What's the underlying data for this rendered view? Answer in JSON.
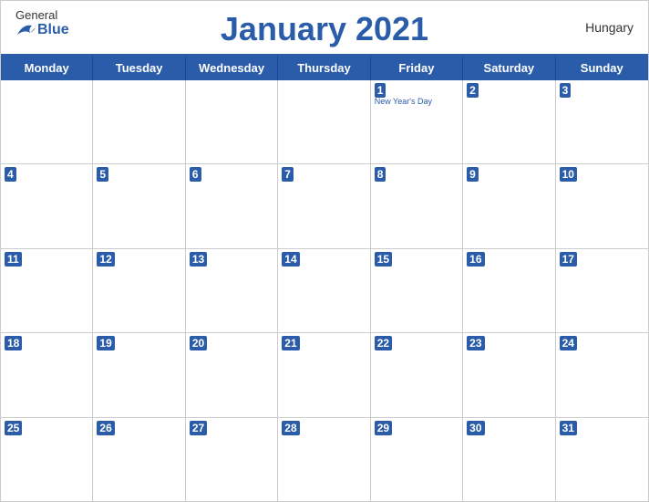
{
  "header": {
    "logo_general": "General",
    "logo_blue": "Blue",
    "title": "January 2021",
    "country": "Hungary"
  },
  "day_headers": [
    "Monday",
    "Tuesday",
    "Wednesday",
    "Thursday",
    "Friday",
    "Saturday",
    "Sunday"
  ],
  "weeks": [
    [
      {
        "day": "",
        "holiday": ""
      },
      {
        "day": "",
        "holiday": ""
      },
      {
        "day": "",
        "holiday": ""
      },
      {
        "day": "",
        "holiday": ""
      },
      {
        "day": "1",
        "holiday": "New Year's Day"
      },
      {
        "day": "2",
        "holiday": ""
      },
      {
        "day": "3",
        "holiday": ""
      }
    ],
    [
      {
        "day": "4",
        "holiday": ""
      },
      {
        "day": "5",
        "holiday": ""
      },
      {
        "day": "6",
        "holiday": ""
      },
      {
        "day": "7",
        "holiday": ""
      },
      {
        "day": "8",
        "holiday": ""
      },
      {
        "day": "9",
        "holiday": ""
      },
      {
        "day": "10",
        "holiday": ""
      }
    ],
    [
      {
        "day": "11",
        "holiday": ""
      },
      {
        "day": "12",
        "holiday": ""
      },
      {
        "day": "13",
        "holiday": ""
      },
      {
        "day": "14",
        "holiday": ""
      },
      {
        "day": "15",
        "holiday": ""
      },
      {
        "day": "16",
        "holiday": ""
      },
      {
        "day": "17",
        "holiday": ""
      }
    ],
    [
      {
        "day": "18",
        "holiday": ""
      },
      {
        "day": "19",
        "holiday": ""
      },
      {
        "day": "20",
        "holiday": ""
      },
      {
        "day": "21",
        "holiday": ""
      },
      {
        "day": "22",
        "holiday": ""
      },
      {
        "day": "23",
        "holiday": ""
      },
      {
        "day": "24",
        "holiday": ""
      }
    ],
    [
      {
        "day": "25",
        "holiday": ""
      },
      {
        "day": "26",
        "holiday": ""
      },
      {
        "day": "27",
        "holiday": ""
      },
      {
        "day": "28",
        "holiday": ""
      },
      {
        "day": "29",
        "holiday": ""
      },
      {
        "day": "30",
        "holiday": ""
      },
      {
        "day": "31",
        "holiday": ""
      }
    ]
  ]
}
